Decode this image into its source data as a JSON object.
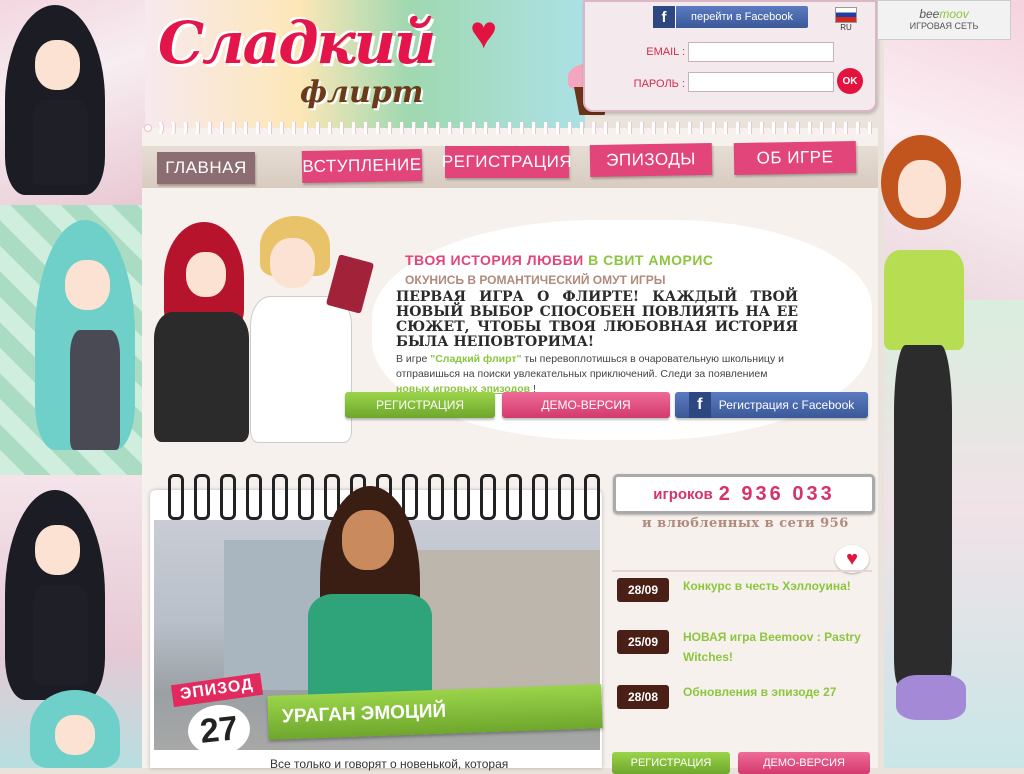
{
  "header": {
    "logo_title": "Сладкий",
    "logo_subtitle": "флирт",
    "facebook_button": "перейти в Facebook",
    "language": "RU",
    "email_label": "EMAIL :",
    "password_label": "ПАРОЛЬ :",
    "ok_button": "OK",
    "network_brand_prefix": "bee",
    "network_brand_suffix": "moov",
    "network_label": "ИГРОВАЯ СЕТЬ"
  },
  "nav": {
    "items": [
      {
        "label": "ГЛАВНАЯ"
      },
      {
        "label": "ВСТУПЛЕНИЕ"
      },
      {
        "label": "РЕГИСТРАЦИЯ"
      },
      {
        "label": "ЭПИЗОДЫ"
      },
      {
        "label": "ОБ ИГРЕ"
      }
    ]
  },
  "hero": {
    "tagline_part1": "ТВОЯ ИСТОРИЯ ЛЮБВИ ",
    "tagline_part2": "В СВИТ АМОРИС",
    "tagline_sub": "ОКУНИСЬ В РОМАНТИЧЕСКИЙ ОМУТ ИГРЫ",
    "heading": "ПЕРВАЯ ИГРА О ФЛИРТЕ! КАЖДЫЙ ТВОЙ НОВЫЙ ВЫБОР СПОСОБЕН ПОВЛИЯТЬ НА ЕЕ СЮЖЕТ, ЧТОБЫ ТВОЯ ЛЮБОВНАЯ ИСТОРИЯ БЫЛА НЕПОВТОРИМА!",
    "text_before": "В игре ",
    "game_name": "\"Сладкий флирт\"",
    "text_after": " ты перевоплотишься в очаровательную школьницу и отправишься на поиски увлекательных приключений. Следи за появлением ",
    "text_link": "новых игровых эпизодов",
    "text_end": " !",
    "btn_register": "РЕГИСТРАЦИЯ",
    "btn_demo": "ДЕМО-ВЕРСИЯ",
    "btn_facebook": "Регистрация с Facebook"
  },
  "episode": {
    "label": "ЭПИЗОД",
    "number": "27",
    "title": "УРАГАН ЭМОЦИЙ",
    "description": "Все только и говорят о новенькой, которая"
  },
  "stats": {
    "players_label": "игроков",
    "players_count": "2 936 033",
    "online_text": "и влюбленных в сети 956"
  },
  "news": [
    {
      "date": "28/09",
      "text": "Конкурс в честь Хэллоуина!"
    },
    {
      "date": "25/09",
      "text": "НОВАЯ игра Beemoov : Pastry Witches!"
    },
    {
      "date": "28/08",
      "text": "Обновления в эпизоде 27"
    }
  ],
  "side_buttons": {
    "register": "РЕГИСТРАЦИЯ",
    "demo": "ДЕМО-ВЕРСИЯ"
  },
  "colors": {
    "brand_pink": "#e2457a",
    "brand_green": "#8cc63f",
    "facebook_blue": "#3b5998",
    "logo_red": "#e3154a"
  }
}
